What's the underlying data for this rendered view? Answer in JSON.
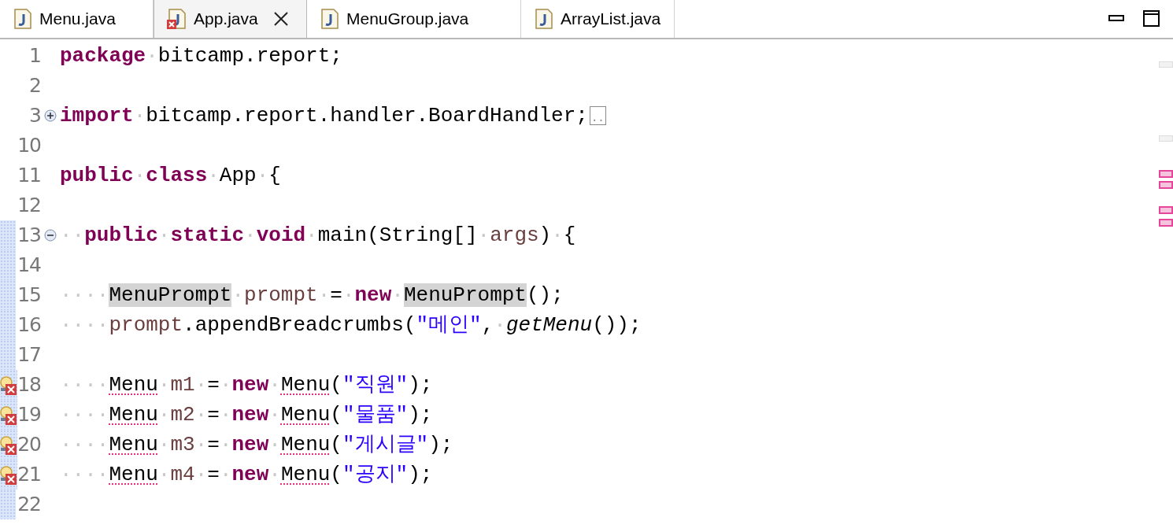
{
  "tabs": [
    {
      "label": "Menu.java",
      "selected": false,
      "error": false,
      "closable": false
    },
    {
      "label": "App.java",
      "selected": true,
      "error": true,
      "closable": true
    },
    {
      "label": "MenuGroup.java",
      "selected": false,
      "error": false,
      "closable": false
    },
    {
      "label": "ArrayList.java",
      "selected": false,
      "error": false,
      "closable": false
    }
  ],
  "lines": [
    {
      "number": "1",
      "error": false,
      "range": false,
      "tokens": [
        {
          "kind": "keyword",
          "text": "package"
        },
        {
          "kind": "ws",
          "text": "·"
        },
        {
          "kind": "plain",
          "text": "bitcamp.report;"
        }
      ]
    },
    {
      "number": "2",
      "error": false,
      "range": false
    },
    {
      "number": "3",
      "fold": {
        "expanded": false
      },
      "error": false,
      "range": false,
      "tokens": [
        {
          "kind": "keyword",
          "text": "import"
        },
        {
          "kind": "ws",
          "text": "·"
        },
        {
          "kind": "plain",
          "text": "bitcamp.report.handler.BoardHandler;"
        },
        {
          "kind": "folded",
          "text": ".."
        }
      ]
    },
    {
      "number": "10",
      "error": false,
      "range": false
    },
    {
      "number": "11",
      "error": false,
      "range": false,
      "tokens": [
        {
          "kind": "keyword",
          "text": "public"
        },
        {
          "kind": "ws",
          "text": "·"
        },
        {
          "kind": "keyword",
          "text": "class"
        },
        {
          "kind": "ws",
          "text": "·"
        },
        {
          "kind": "plain",
          "text": "App"
        },
        {
          "kind": "ws",
          "text": "·"
        },
        {
          "kind": "plain",
          "text": "{"
        }
      ]
    },
    {
      "number": "12",
      "error": false,
      "range": false
    },
    {
      "number": "13",
      "fold": {
        "expanded": true
      },
      "error": false,
      "range": true,
      "tokens": [
        {
          "kind": "ws",
          "text": "··"
        },
        {
          "kind": "keyword",
          "text": "public"
        },
        {
          "kind": "ws",
          "text": "·"
        },
        {
          "kind": "keyword",
          "text": "static"
        },
        {
          "kind": "ws",
          "text": "·"
        },
        {
          "kind": "keyword",
          "text": "void"
        },
        {
          "kind": "ws",
          "text": "·"
        },
        {
          "kind": "plain",
          "text": "main(String[]"
        },
        {
          "kind": "ws",
          "text": "·"
        },
        {
          "kind": "local",
          "text": "args"
        },
        {
          "kind": "plain",
          "text": ")"
        },
        {
          "kind": "ws",
          "text": "·"
        },
        {
          "kind": "plain",
          "text": "{"
        }
      ]
    },
    {
      "number": "14",
      "error": false,
      "range": true
    },
    {
      "number": "15",
      "error": false,
      "range": true,
      "tokens": [
        {
          "kind": "ws",
          "text": "····"
        },
        {
          "kind": "plain",
          "text": "MenuPrompt",
          "highlight": true
        },
        {
          "kind": "ws",
          "text": "·"
        },
        {
          "kind": "local",
          "text": "prompt"
        },
        {
          "kind": "ws",
          "text": "·"
        },
        {
          "kind": "plain",
          "text": "="
        },
        {
          "kind": "ws",
          "text": "·"
        },
        {
          "kind": "keyword",
          "text": "new"
        },
        {
          "kind": "ws",
          "text": "·"
        },
        {
          "kind": "plain",
          "text": "MenuPrompt",
          "highlight": true
        },
        {
          "kind": "plain",
          "text": "();"
        }
      ]
    },
    {
      "number": "16",
      "error": false,
      "range": true,
      "tokens": [
        {
          "kind": "ws",
          "text": "····"
        },
        {
          "kind": "local",
          "text": "prompt"
        },
        {
          "kind": "plain",
          "text": ".appendBreadcrumbs("
        },
        {
          "kind": "string",
          "text": "\"메인\""
        },
        {
          "kind": "plain",
          "text": ","
        },
        {
          "kind": "ws",
          "text": "·"
        },
        {
          "kind": "italic",
          "text": "getMenu"
        },
        {
          "kind": "plain",
          "text": "());"
        }
      ]
    },
    {
      "number": "17",
      "error": false,
      "range": true
    },
    {
      "number": "18",
      "error": true,
      "range": true,
      "tokens": [
        {
          "kind": "ws",
          "text": "····"
        },
        {
          "kind": "plain",
          "text": "Menu",
          "error": true
        },
        {
          "kind": "ws",
          "text": "·"
        },
        {
          "kind": "local",
          "text": "m1"
        },
        {
          "kind": "ws",
          "text": "·"
        },
        {
          "kind": "plain",
          "text": "="
        },
        {
          "kind": "ws",
          "text": "·"
        },
        {
          "kind": "keyword",
          "text": "new"
        },
        {
          "kind": "ws",
          "text": "·"
        },
        {
          "kind": "plain",
          "text": "Menu",
          "error": true
        },
        {
          "kind": "plain",
          "text": "("
        },
        {
          "kind": "string",
          "text": "\"직원\""
        },
        {
          "kind": "plain",
          "text": ");"
        }
      ]
    },
    {
      "number": "19",
      "error": true,
      "range": true,
      "tokens": [
        {
          "kind": "ws",
          "text": "····"
        },
        {
          "kind": "plain",
          "text": "Menu",
          "error": true
        },
        {
          "kind": "ws",
          "text": "·"
        },
        {
          "kind": "local",
          "text": "m2"
        },
        {
          "kind": "ws",
          "text": "·"
        },
        {
          "kind": "plain",
          "text": "="
        },
        {
          "kind": "ws",
          "text": "·"
        },
        {
          "kind": "keyword",
          "text": "new"
        },
        {
          "kind": "ws",
          "text": "·"
        },
        {
          "kind": "plain",
          "text": "Menu",
          "error": true
        },
        {
          "kind": "plain",
          "text": "("
        },
        {
          "kind": "string",
          "text": "\"물품\""
        },
        {
          "kind": "plain",
          "text": ");"
        }
      ]
    },
    {
      "number": "20",
      "error": true,
      "range": true,
      "tokens": [
        {
          "kind": "ws",
          "text": "····"
        },
        {
          "kind": "plain",
          "text": "Menu",
          "error": true
        },
        {
          "kind": "ws",
          "text": "·"
        },
        {
          "kind": "local",
          "text": "m3"
        },
        {
          "kind": "ws",
          "text": "·"
        },
        {
          "kind": "plain",
          "text": "="
        },
        {
          "kind": "ws",
          "text": "·"
        },
        {
          "kind": "keyword",
          "text": "new"
        },
        {
          "kind": "ws",
          "text": "·"
        },
        {
          "kind": "plain",
          "text": "Menu",
          "error": true
        },
        {
          "kind": "plain",
          "text": "("
        },
        {
          "kind": "string",
          "text": "\"게시글\""
        },
        {
          "kind": "plain",
          "text": ");"
        }
      ]
    },
    {
      "number": "21",
      "error": true,
      "range": true,
      "tokens": [
        {
          "kind": "ws",
          "text": "····"
        },
        {
          "kind": "plain",
          "text": "Menu",
          "error": true
        },
        {
          "kind": "ws",
          "text": "·"
        },
        {
          "kind": "local",
          "text": "m4"
        },
        {
          "kind": "ws",
          "text": "·"
        },
        {
          "kind": "plain",
          "text": "="
        },
        {
          "kind": "ws",
          "text": "·"
        },
        {
          "kind": "keyword",
          "text": "new"
        },
        {
          "kind": "ws",
          "text": "·"
        },
        {
          "kind": "plain",
          "text": "Menu",
          "error": true
        },
        {
          "kind": "plain",
          "text": "("
        },
        {
          "kind": "string",
          "text": "\"공지\""
        },
        {
          "kind": "plain",
          "text": ");"
        }
      ]
    },
    {
      "number": "22",
      "error": false,
      "range": true
    }
  ],
  "overview_marks": [
    {
      "kind": "occurrence"
    },
    {
      "kind": "occurrence"
    },
    {
      "kind": "error"
    },
    {
      "kind": "error"
    },
    {
      "kind": "error"
    },
    {
      "kind": "error"
    }
  ]
}
